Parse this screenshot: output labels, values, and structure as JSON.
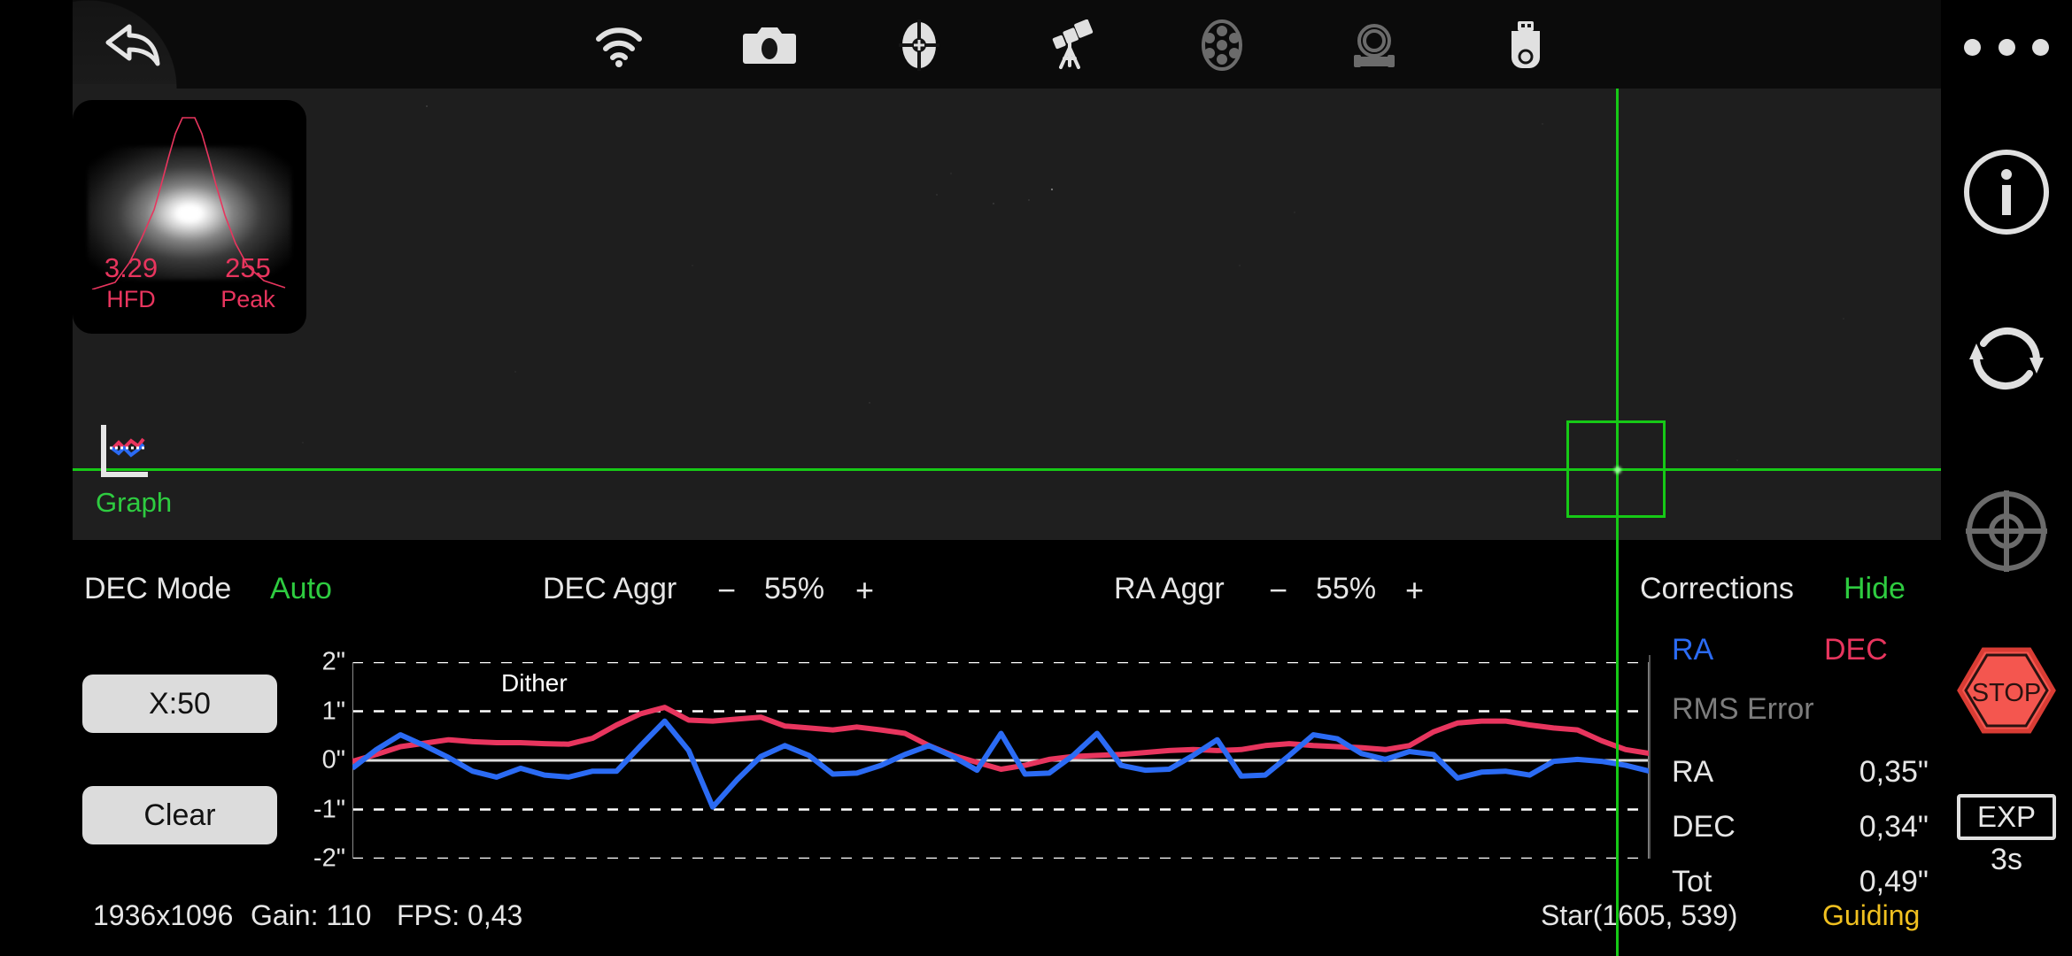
{
  "topbar": {
    "back_label": "back",
    "icons": [
      {
        "name": "wifi-icon",
        "label": "WiFi"
      },
      {
        "name": "camera-icon",
        "label": "Camera"
      },
      {
        "name": "guide-scope-icon",
        "label": "Guider"
      },
      {
        "name": "telescope-icon",
        "label": "Mount"
      },
      {
        "name": "filter-wheel-icon",
        "label": "Filter Wheel"
      },
      {
        "name": "focuser-icon",
        "label": "Focuser"
      },
      {
        "name": "usb-drive-icon",
        "label": "USB Storage"
      }
    ]
  },
  "star_profile": {
    "hfd_value": "3.29",
    "hfd_label": "HFD",
    "peak_value": "255",
    "peak_label": "Peak",
    "accent_color": "#e8355e"
  },
  "graph_toggle": {
    "label": "Graph",
    "color": "#2ecc40"
  },
  "controls": {
    "dec_mode_label": "DEC Mode",
    "dec_mode_value": "Auto",
    "dec_aggr_label": "DEC Aggr",
    "dec_aggr_minus": "−",
    "dec_aggr_value": "55%",
    "dec_aggr_plus": "+",
    "ra_aggr_label": "RA Aggr",
    "ra_aggr_minus": "−",
    "ra_aggr_value": "55%",
    "ra_aggr_plus": "+",
    "corrections_label": "Corrections",
    "corrections_action": "Hide"
  },
  "graph_buttons": {
    "scale": "X:50",
    "clear": "Clear"
  },
  "rms": {
    "ra_header": "RA",
    "dec_header": "DEC",
    "ra_header_color": "#2b6bf4",
    "dec_header_color": "#e8355e",
    "title": "RMS Error",
    "rows": [
      {
        "key": "RA",
        "value": "0,35\""
      },
      {
        "key": "DEC",
        "value": "0,34\""
      },
      {
        "key": "Tot",
        "value": "0,49\""
      }
    ]
  },
  "status": {
    "resolution": "1936x1096",
    "gain": "Gain: 110",
    "fps": "FPS: 0,43",
    "star": "Star(1605, 539)",
    "state": "Guiding",
    "state_color": "#f0c020"
  },
  "sidebar": {
    "more_label": "More options",
    "info_label": "Info",
    "refresh_label": "Refresh",
    "target_label": "Select Star",
    "stop_label": "STOP",
    "exp_label": "EXP",
    "exp_value": "3s"
  },
  "chart_data": {
    "type": "line",
    "title": "Guiding corrections",
    "xlabel": "",
    "ylabel": "arcsec",
    "ylim": [
      -2,
      2
    ],
    "yticks": [
      "2\"",
      "1\"",
      "0\"",
      "-1\"",
      "-2\""
    ],
    "ytick_values": [
      2,
      1,
      0,
      -1,
      -2
    ],
    "grid": true,
    "legend": [
      "RA",
      "DEC"
    ],
    "annotations": [
      {
        "text": "Dither",
        "x_index": 9,
        "y": 1.85
      }
    ],
    "x_scale": "X:50",
    "series": [
      {
        "name": "DEC",
        "color": "#e8355e",
        "values": [
          -0.02,
          0.12,
          0.28,
          0.35,
          0.42,
          0.38,
          0.36,
          0.36,
          0.34,
          0.33,
          0.45,
          0.72,
          0.95,
          1.08,
          0.82,
          0.8,
          0.84,
          0.88,
          0.7,
          0.66,
          0.62,
          0.68,
          0.62,
          0.55,
          0.3,
          0.1,
          -0.04,
          -0.18,
          -0.1,
          0.02,
          0.08,
          0.1,
          0.12,
          0.16,
          0.2,
          0.22,
          0.2,
          0.22,
          0.3,
          0.34,
          0.3,
          0.28,
          0.26,
          0.22,
          0.3,
          0.58,
          0.76,
          0.8,
          0.8,
          0.72,
          0.66,
          0.62,
          0.4,
          0.22,
          0.14
        ]
      },
      {
        "name": "RA",
        "color": "#2b6bf4",
        "values": [
          -0.16,
          0.22,
          0.52,
          0.3,
          0.06,
          -0.22,
          -0.34,
          -0.16,
          -0.3,
          -0.34,
          -0.22,
          -0.22,
          0.3,
          0.8,
          0.2,
          -0.95,
          -0.4,
          0.08,
          0.3,
          0.1,
          -0.28,
          -0.26,
          -0.1,
          0.12,
          0.3,
          0.08,
          -0.2,
          0.55,
          -0.28,
          -0.26,
          0.1,
          0.55,
          -0.1,
          -0.2,
          -0.18,
          0.1,
          0.42,
          -0.32,
          -0.3,
          0.1,
          0.52,
          0.44,
          0.14,
          0.02,
          0.18,
          0.12,
          -0.36,
          -0.24,
          -0.22,
          -0.3,
          -0.02,
          0.02,
          -0.02,
          -0.1,
          -0.22
        ]
      }
    ]
  }
}
